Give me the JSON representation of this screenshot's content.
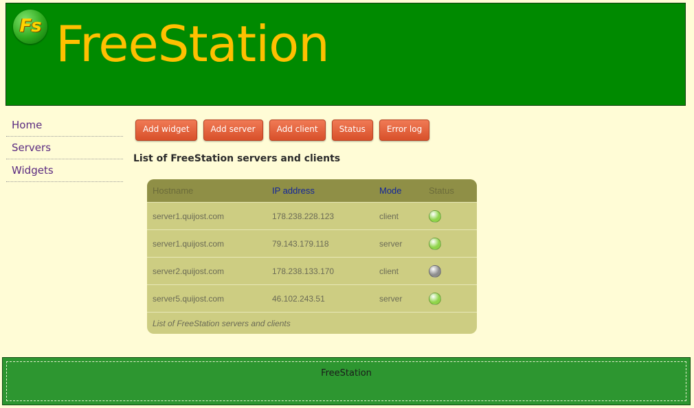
{
  "header": {
    "logo_text": "Fs",
    "title": "FreeStation"
  },
  "sidebar": {
    "items": [
      {
        "label": "Home"
      },
      {
        "label": "Servers"
      },
      {
        "label": "Widgets"
      }
    ]
  },
  "toolbar": {
    "buttons": [
      {
        "label": "Add widget"
      },
      {
        "label": "Add server"
      },
      {
        "label": "Add client"
      },
      {
        "label": "Status"
      },
      {
        "label": "Error log"
      }
    ]
  },
  "main": {
    "heading": "List of FreeStation servers and clients"
  },
  "table": {
    "columns": [
      {
        "label": "Hostname",
        "color": "#6b6b3a"
      },
      {
        "label": "IP address",
        "color": "#12259a"
      },
      {
        "label": "Mode",
        "color": "#12259a"
      },
      {
        "label": "Status",
        "color": "#6b6b3a"
      }
    ],
    "rows": [
      {
        "hostname": "server1.quijost.com",
        "ip": "178.238.228.123",
        "mode": "client",
        "status_icon": "status-online-icon",
        "status_color": "#8fd44a"
      },
      {
        "hostname": "server1.quijost.com",
        "ip": "79.143.179.118",
        "mode": "server",
        "status_icon": "status-online-icon",
        "status_color": "#8fd44a"
      },
      {
        "hostname": "server2.quijost.com",
        "ip": "178.238.133.170",
        "mode": "client",
        "status_icon": "status-offline-icon",
        "status_color": "#8d8d8d"
      },
      {
        "hostname": "server5.quijost.com",
        "ip": "46.102.243.51",
        "mode": "server",
        "status_icon": "status-online-icon",
        "status_color": "#8fd44a"
      }
    ],
    "caption": "List of FreeStation servers and clients"
  },
  "footer": {
    "text": "FreeStation"
  },
  "colors": {
    "header_bg": "#008a00",
    "title": "#ffc000",
    "button": "#e0603a",
    "footer_bg": "#2d9630",
    "page_bg": "#fffcd6"
  }
}
